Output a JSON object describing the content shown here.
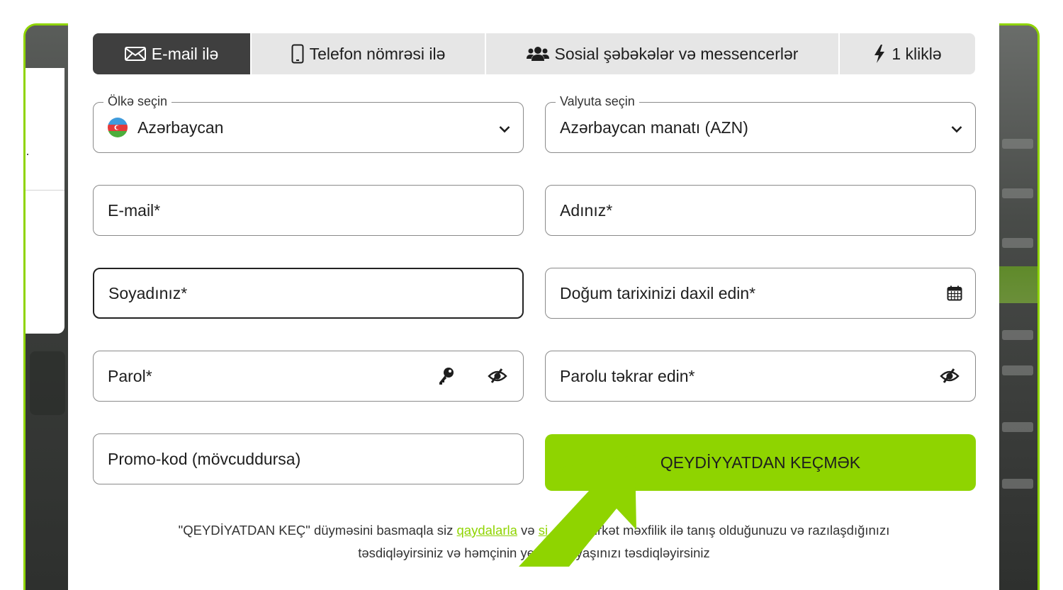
{
  "tabs": [
    {
      "label": "E-mail ilə",
      "icon": "envelope-icon",
      "active": true
    },
    {
      "label": "Telefon nömrəsi ilə",
      "icon": "mobile-phone-icon",
      "active": false
    },
    {
      "label": "Sosial şəbəkələr və messencerlər",
      "icon": "users-icon",
      "active": false
    },
    {
      "label": "1 kliklə",
      "icon": "lightning-icon",
      "active": false
    }
  ],
  "form": {
    "country": {
      "legend": "Ölkə seçin",
      "value": "Azərbaycan",
      "flag": "azerbaijan-flag-icon"
    },
    "currency": {
      "legend": "Valyuta seçin",
      "value": "Azərbaycan manatı (AZN)"
    },
    "email": {
      "placeholder": "E-mail*"
    },
    "first_name": {
      "placeholder": "Adınız*"
    },
    "last_name": {
      "placeholder": "Soyadınız*"
    },
    "birth_date": {
      "placeholder": "Doğum tarixinizi daxil edin*"
    },
    "password": {
      "placeholder": "Parol*"
    },
    "password_repeat": {
      "placeholder": "Parolu təkrar edin*"
    },
    "promo": {
      "placeholder": "Promo-kod (mövcuddursa)"
    }
  },
  "submit_label": "QEYDİYYATDAN KEÇMƏK",
  "terms": {
    "before": "\"QEYDİYATDAN KEÇ\" düyməsini basmaqla siz ",
    "link1": "qaydalarla",
    "middle1": " və ",
    "link2": "si",
    "middle2": "           şirkət məxfilik ilə tanış olduğunuzu və razılaşdığınızı",
    "line2": "təsdiqləyirsiniz və həmçinin yetkin   k yaşınızı təsdiqləyirsiniz"
  },
  "colors": {
    "accent": "#8fd400",
    "active_tab": "#3f3f3f",
    "tab_bg": "#e6e6e6",
    "arrow": "#8fd400"
  }
}
